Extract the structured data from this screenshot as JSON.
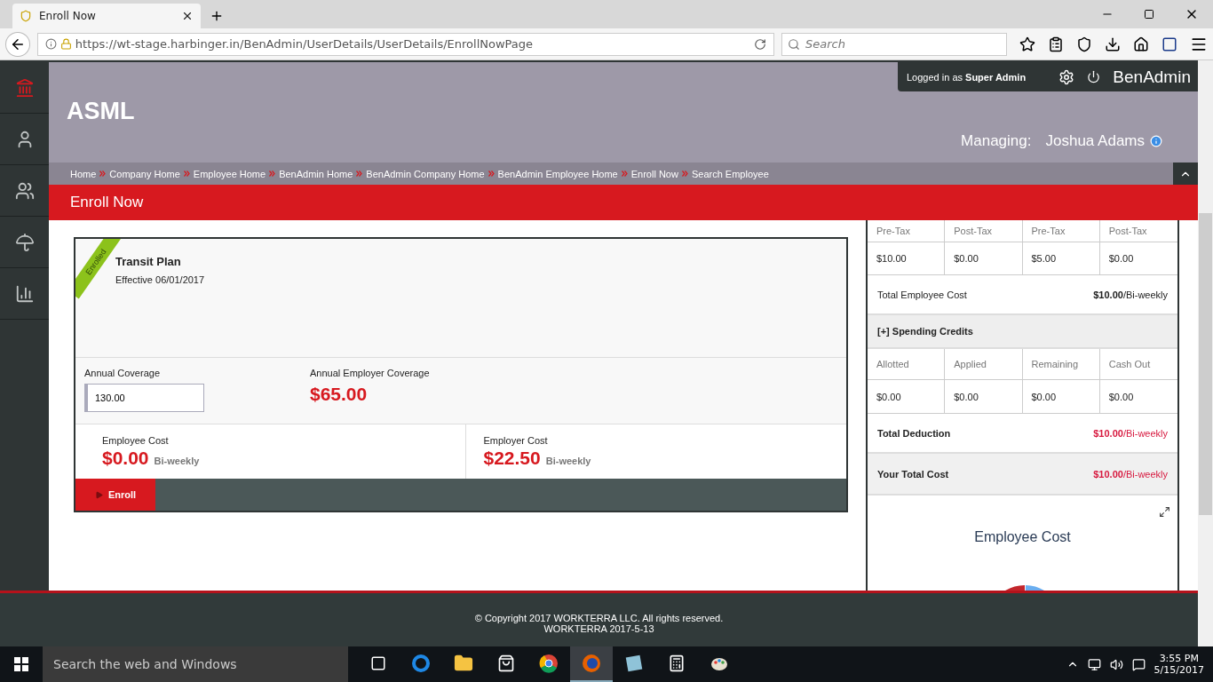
{
  "browser": {
    "tab_title": "Enroll Now",
    "url": "https://wt-stage.harbinger.in/BenAdmin/UserDetails/UserDetails/EnrollNowPage",
    "search": {
      "placeholder": "Search"
    }
  },
  "sidebar": {
    "items": [
      {
        "kind": "home",
        "selected": true
      },
      {
        "kind": "user",
        "selected": false
      },
      {
        "kind": "users",
        "selected": false
      },
      {
        "kind": "benefits",
        "selected": false
      },
      {
        "kind": "reports",
        "selected": false
      }
    ]
  },
  "header": {
    "logo": "ASML",
    "logged_in": "Logged in as **Super Admin**",
    "app_name": "BenAdmin",
    "managing_label": "Managing:",
    "managing_name": "Joshua Adams"
  },
  "breadcrumb": [
    "Home",
    "Company Home",
    "Employee Home",
    "BenAdmin Home",
    "BenAdmin Company Home",
    "BenAdmin Employee Home",
    "Enroll Now",
    "Search Employee"
  ],
  "page_title": "Enroll Now",
  "plan": {
    "ribbon": "Enrolled",
    "title": "Transit Plan",
    "effective": "Effective 06/01/2017",
    "coverage_label": "Annual Coverage",
    "coverage_value": "130.00",
    "employer_coverage_label": "Annual Employer Coverage",
    "employer_coverage": "$65.00",
    "costs": [
      {
        "label": "Employee Cost",
        "amount": "$0.00",
        "period": "Bi-weekly"
      },
      {
        "label": "Employer Cost",
        "amount": "$22.50",
        "period": "Bi-weekly"
      }
    ],
    "enroll_button": "Enroll"
  },
  "summary": {
    "tax_headers": [
      "Pre-Tax",
      "Post-Tax",
      "Pre-Tax",
      "Post-Tax"
    ],
    "tax_values": [
      "$10.00",
      "$0.00",
      "$5.00",
      "$0.00"
    ],
    "total_employee_cost": {
      "label": "Total Employee Cost",
      "value": "**$10.00**/Bi-weekly"
    },
    "credits_title": "[+] Spending Credits",
    "credit_headers": [
      "Allotted",
      "Applied",
      "Remaining",
      "Cash Out"
    ],
    "credit_values": [
      "$0.00",
      "$0.00",
      "$0.00",
      "$0.00"
    ],
    "total_deduction": {
      "label": "Total Deduction",
      "value": "**$10.00**/Bi-weekly"
    },
    "your_total_cost": {
      "label": "Your Total Cost",
      "value": "**$10.00**/Bi-weekly"
    },
    "chart_title": "Employee Cost"
  },
  "footer": {
    "copyright": "© Copyright 2017 WORKTERRA LLC. All rights reserved.",
    "version": "WORKTERRA 2017-5-13"
  },
  "taskbar": {
    "search_placeholder": "Search the web and Windows",
    "apps": [
      {
        "kind": "taskview",
        "selected": false
      },
      {
        "kind": "edge",
        "selected": false
      },
      {
        "kind": "explorer",
        "selected": false
      },
      {
        "kind": "store",
        "selected": false
      },
      {
        "kind": "chrome",
        "selected": false
      },
      {
        "kind": "firefox",
        "selected": true
      },
      {
        "kind": "notes",
        "selected": false
      },
      {
        "kind": "calculator",
        "selected": false
      },
      {
        "kind": "paint",
        "selected": false
      }
    ],
    "time": "3:55 PM",
    "date": "5/15/2017"
  }
}
